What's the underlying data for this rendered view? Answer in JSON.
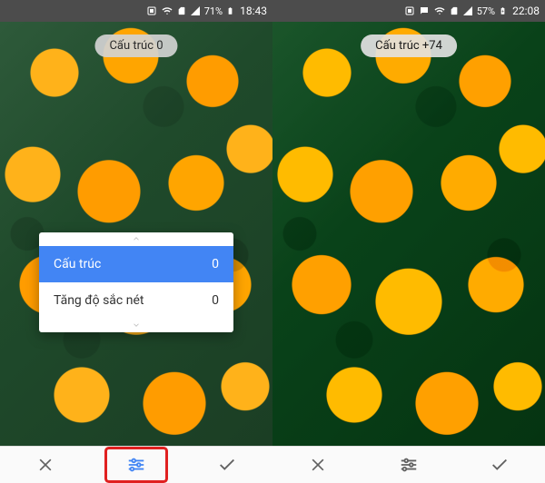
{
  "left": {
    "status": {
      "battery_pct": "71%",
      "clock": "18:43"
    },
    "pill_label": "Cấu trúc 0",
    "panel": {
      "rows": [
        {
          "label": "Cấu trúc",
          "value": "0",
          "active": true
        },
        {
          "label": "Tăng độ sắc nét",
          "value": "0",
          "active": false
        }
      ]
    }
  },
  "right": {
    "status": {
      "battery_pct": "57%",
      "clock": "22:08"
    },
    "pill_label": "Cấu trúc +74"
  },
  "icons": {
    "cancel": "close-icon",
    "adjust": "sliders-icon",
    "confirm": "check-icon"
  }
}
